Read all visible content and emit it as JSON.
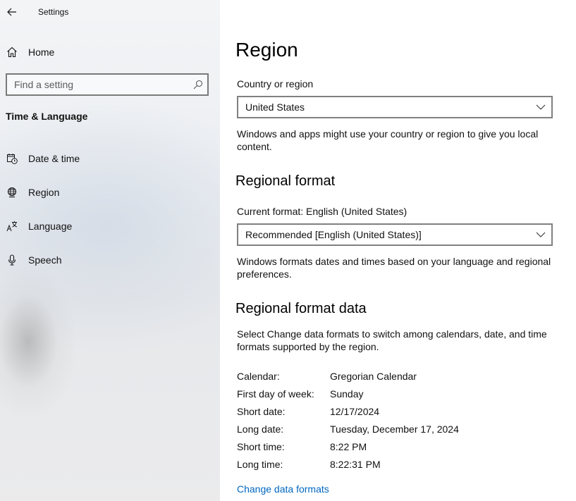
{
  "window": {
    "title": "Settings"
  },
  "sidebar": {
    "home_label": "Home",
    "search": {
      "placeholder": "Find a setting",
      "value": ""
    },
    "section_heading": "Time & Language",
    "items": [
      {
        "id": "date-time",
        "label": "Date & time",
        "icon": "calendar-clock-icon"
      },
      {
        "id": "region",
        "label": "Region",
        "icon": "globe-icon",
        "selected": true
      },
      {
        "id": "language",
        "label": "Language",
        "icon": "language-icon"
      },
      {
        "id": "speech",
        "label": "Speech",
        "icon": "microphone-icon"
      }
    ]
  },
  "main": {
    "title": "Region",
    "country": {
      "label": "Country or region",
      "value": "United States",
      "description": "Windows and apps might use your country or region to give you local content."
    },
    "regional_format": {
      "heading": "Regional format",
      "current_label": "Current format: English (United States)",
      "value": "Recommended [English (United States)]",
      "description": "Windows formats dates and times based on your language and regional preferences."
    },
    "format_data": {
      "heading": "Regional format data",
      "description": "Select Change data formats to switch among calendars, date, and time formats supported by the region.",
      "rows": [
        {
          "key": "Calendar:",
          "value": "Gregorian Calendar"
        },
        {
          "key": "First day of week:",
          "value": "Sunday"
        },
        {
          "key": "Short date:",
          "value": "12/17/2024"
        },
        {
          "key": "Long date:",
          "value": "Tuesday, December 17, 2024"
        },
        {
          "key": "Short time:",
          "value": "8:22 PM"
        },
        {
          "key": "Long time:",
          "value": "8:22:31 PM"
        }
      ],
      "link_label": "Change data formats"
    }
  },
  "colors": {
    "accent": "#0067c0",
    "border": "#808080"
  }
}
